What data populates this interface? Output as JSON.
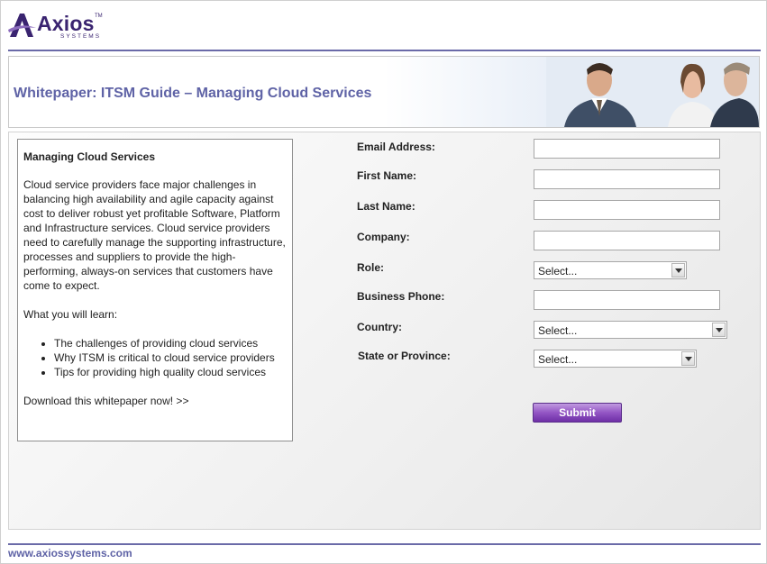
{
  "brand": {
    "name": "Axios",
    "tagline": "SYSTEMS",
    "tm": "TM",
    "color": "#3a2470"
  },
  "banner": {
    "title": "Whitepaper: ITSM Guide – Managing Cloud Services"
  },
  "description": {
    "heading": "Managing Cloud Services",
    "body": "Cloud service providers face major challenges in balancing high availability and agile capacity against cost to deliver robust yet profitable Software, Platform and Infrastructure services. Cloud service providers need to carefully manage the supporting infrastructure, processes and suppliers to provide the high-performing, always-on services that customers have come to expect.",
    "learn_intro": "What you will learn:",
    "bullets": [
      "The challenges of providing cloud services",
      "Why ITSM is critical to cloud service providers",
      "Tips for providing high quality cloud services"
    ],
    "cta": "Download this whitepaper now! >>"
  },
  "form": {
    "email_label": "Email Address:",
    "first_name_label": "First Name:",
    "last_name_label": "Last Name:",
    "company_label": "Company:",
    "role_label": "Role:",
    "role_value": "Select...",
    "phone_label": "Business Phone:",
    "country_label": "Country:",
    "country_value": "Select...",
    "state_label": "State or Province:",
    "state_value": "Select...",
    "submit_label": "Submit"
  },
  "footer": {
    "url": "www.axiossystems.com"
  },
  "colors": {
    "accent": "#5f63a6",
    "rule": "#6a6aa8",
    "button": "#9355c4"
  }
}
